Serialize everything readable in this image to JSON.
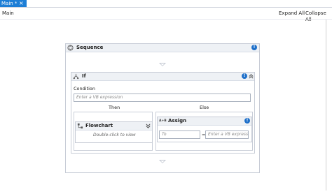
{
  "tabs": [
    {
      "label": "Main *",
      "close": "×"
    }
  ],
  "breadcrumb": "Main",
  "toolbar": {
    "expand_all": "Expand All",
    "collapse_all": "Collapse All"
  },
  "sequence": {
    "title": "Sequence",
    "info": "!"
  },
  "if_activity": {
    "title": "If",
    "info": "!",
    "condition_label": "Condition",
    "condition_placeholder": "Enter a VB expression",
    "then_label": "Then",
    "else_label": "Else"
  },
  "flowchart": {
    "title": "Flowchart",
    "hint": "Double-click to view"
  },
  "assign": {
    "badge": "A+B",
    "title": "Assign",
    "info": "!",
    "to_placeholder": "To",
    "equals": "=",
    "value_placeholder": "Enter a VB expressi"
  },
  "colors": {
    "accent": "#1d7ed6",
    "info": "#1d6fc9",
    "header_bg": "#eef1f5"
  }
}
